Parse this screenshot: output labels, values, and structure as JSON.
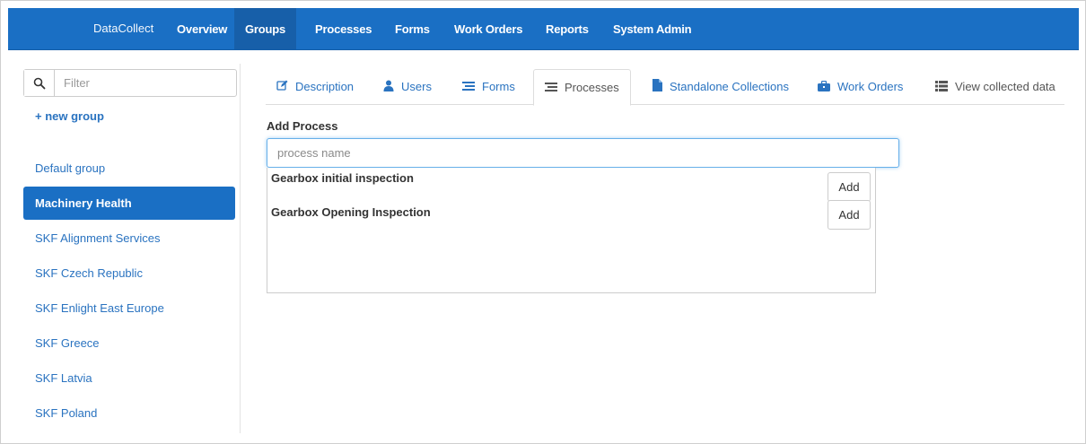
{
  "nav": {
    "brand": "DataCollect",
    "items": [
      "Overview",
      "Groups",
      "Processes",
      "Forms",
      "Work Orders",
      "Reports",
      "System Admin"
    ],
    "active": "Groups"
  },
  "sidebar": {
    "filter_placeholder": "Filter",
    "new_group": "+ new group",
    "groups": [
      "Default group",
      "Machinery Health",
      "SKF Alignment Services",
      "SKF Czech Republic",
      "SKF Enlight East Europe",
      "SKF Greece",
      "SKF Latvia",
      "SKF Poland"
    ],
    "active_group": "Machinery Health"
  },
  "tabs": [
    {
      "label": "Description",
      "icon": "edit-icon"
    },
    {
      "label": "Users",
      "icon": "user-icon"
    },
    {
      "label": "Forms",
      "icon": "list-icon"
    },
    {
      "label": "Processes",
      "icon": "list-icon"
    },
    {
      "label": "Standalone Collections",
      "icon": "file-icon"
    },
    {
      "label": "Work Orders",
      "icon": "briefcase-icon"
    },
    {
      "label": "View collected data",
      "icon": "table-list-icon"
    }
  ],
  "active_tab": "Processes",
  "content": {
    "title": "Add Process",
    "input_placeholder": "process name",
    "input_value": "",
    "results": [
      {
        "name": "Gearbox initial inspection",
        "button": "Add"
      },
      {
        "name": "Gearbox Opening Inspection",
        "button": "Add"
      }
    ]
  },
  "colors": {
    "nav_bg": "#1a6fc4",
    "link": "#2a73c0",
    "active_bg": "#1a6fc4"
  }
}
